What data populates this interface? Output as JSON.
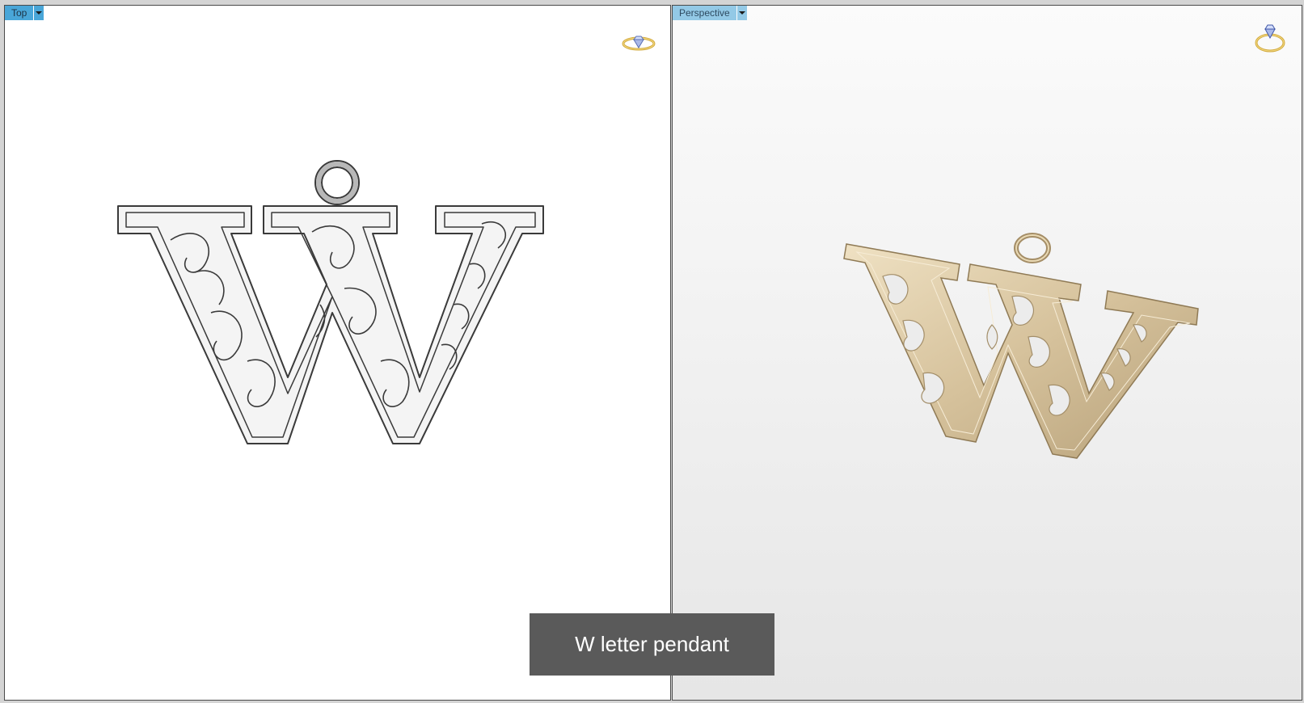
{
  "viewports": {
    "top": {
      "label": "Top"
    },
    "perspective": {
      "label": "Perspective"
    }
  },
  "caption": "W letter pendant",
  "icons": {
    "view_menu": "chevron-down-icon",
    "render_badge": "diamond-ring-icon"
  },
  "colors": {
    "active_tab": "#49a6d8",
    "inactive_tab": "#93c9e6",
    "gold": "#d9c49f",
    "caption_bg": "#5a5a5a"
  }
}
